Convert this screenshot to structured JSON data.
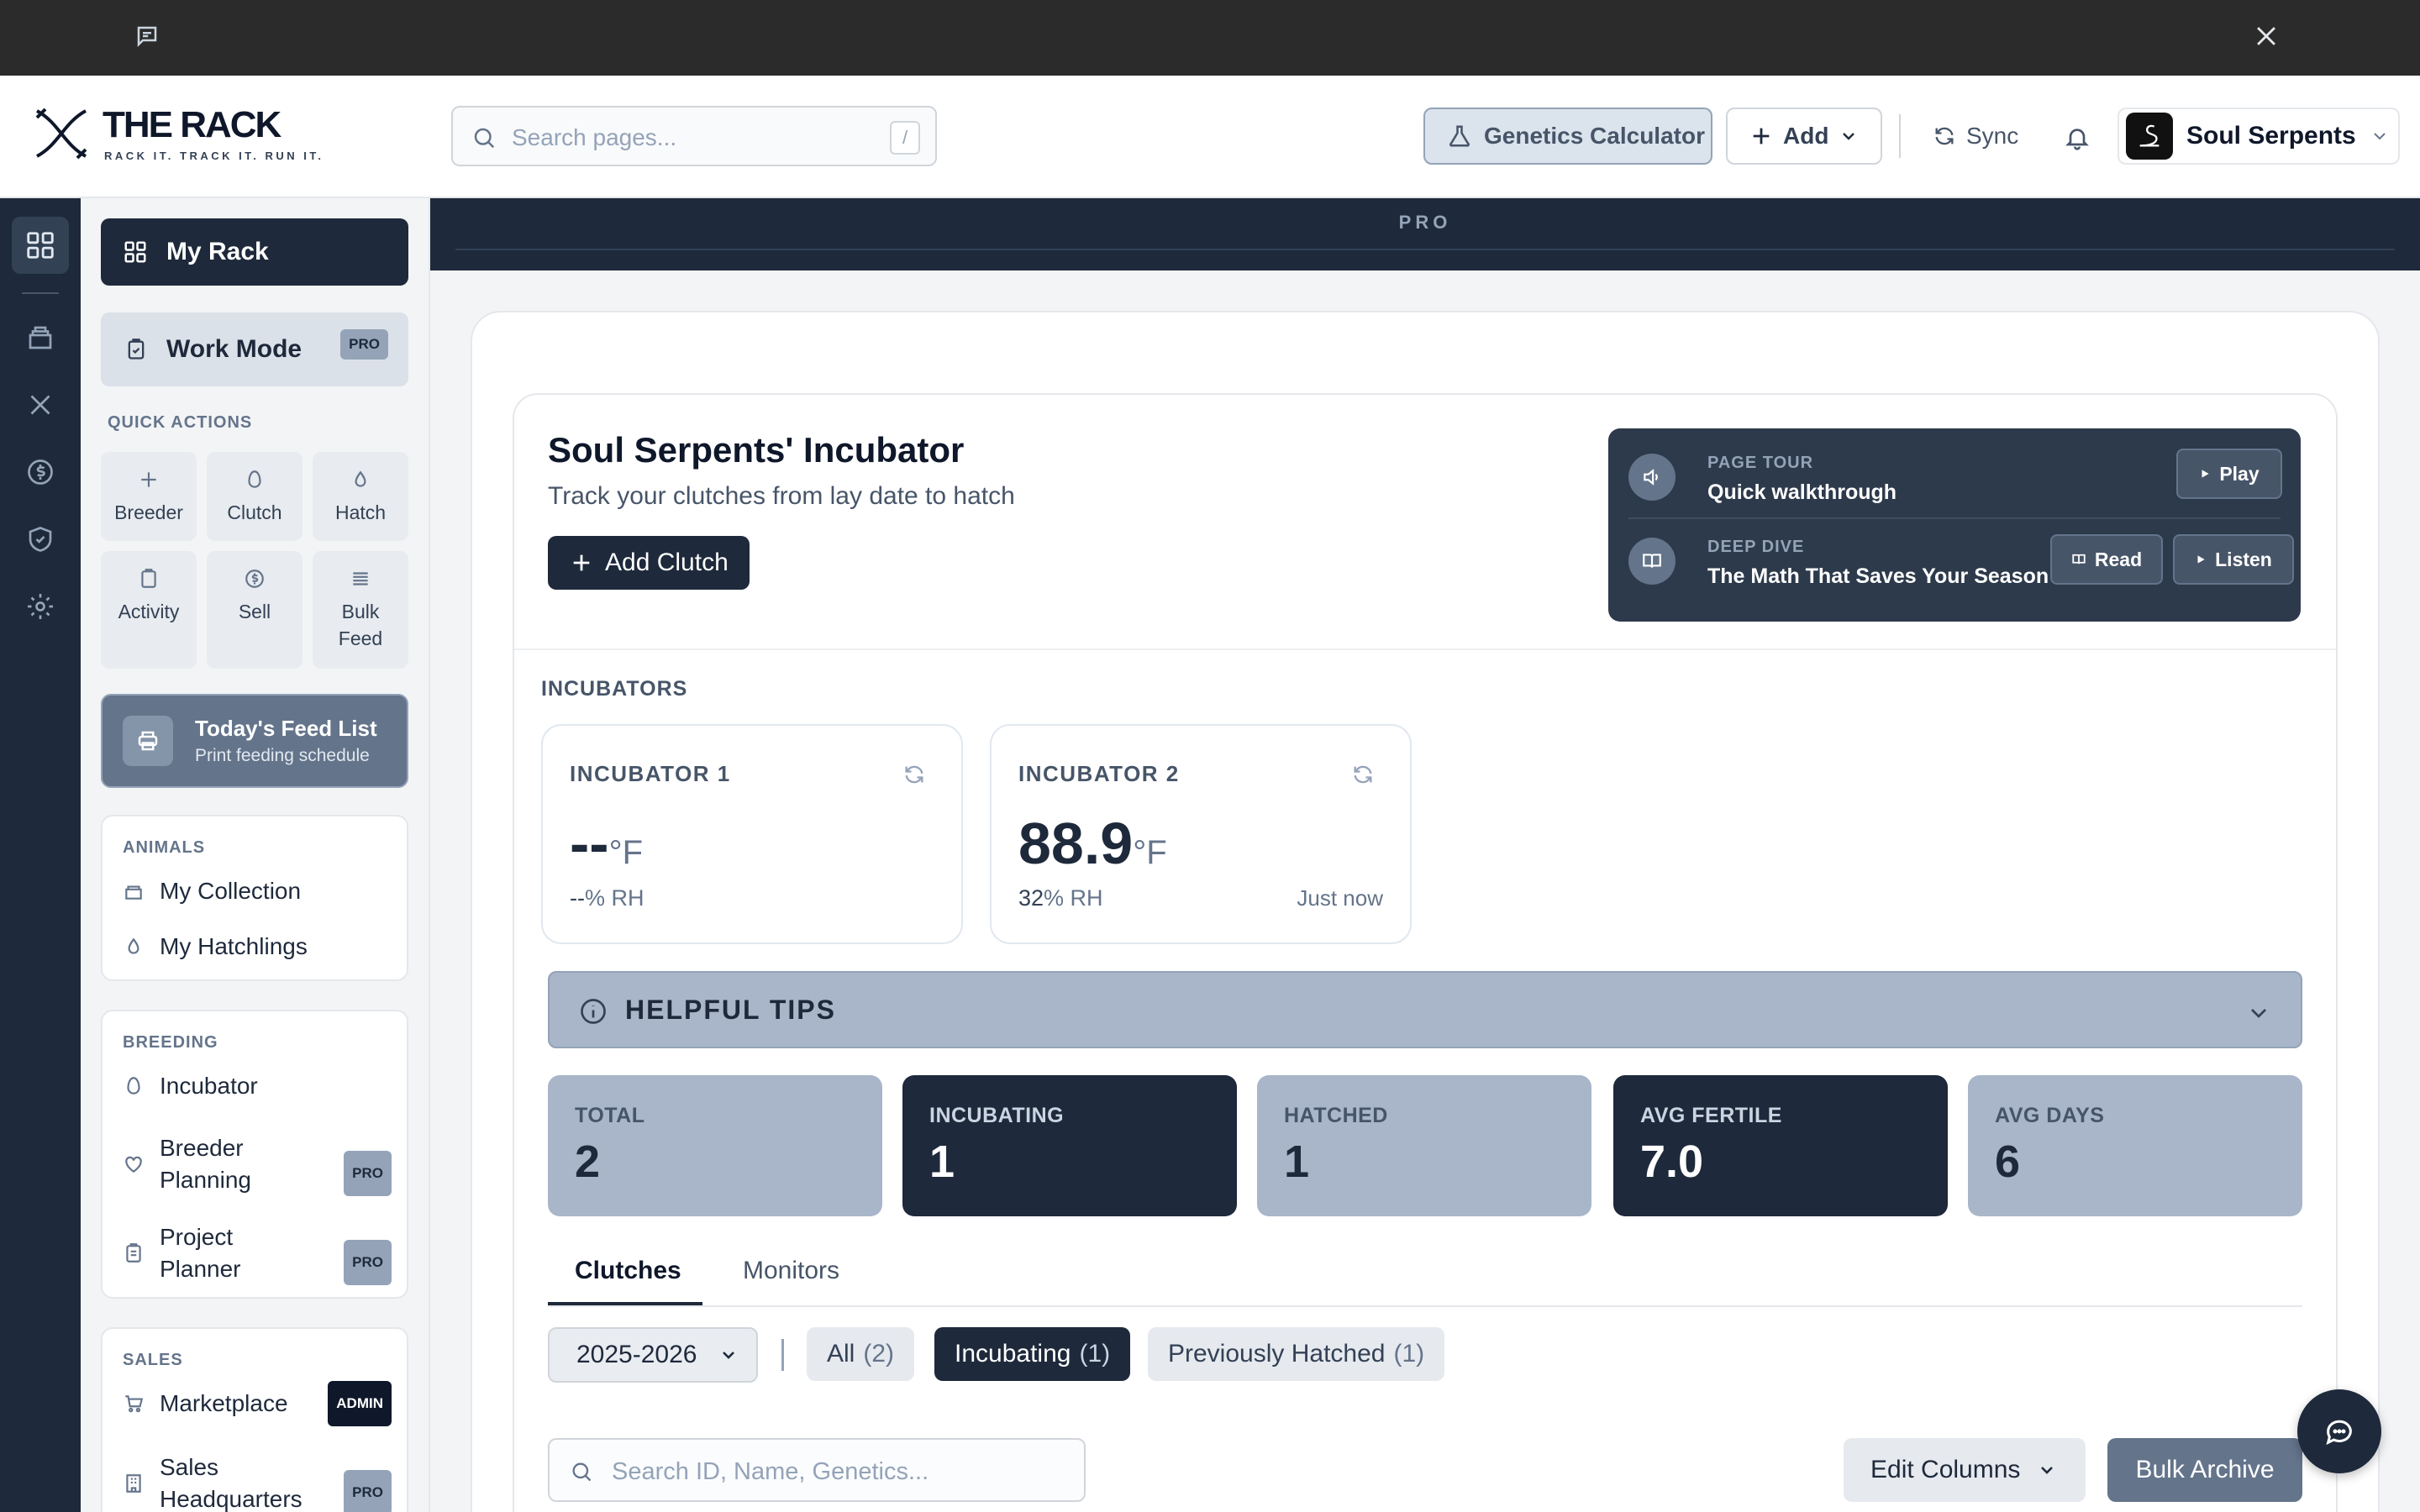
{
  "window": {
    "chat_icon": "message-square-icon",
    "close_icon": "x-icon"
  },
  "brand": {
    "name": "THE RACK",
    "tagline": "RACK IT. TRACK IT. RUN IT."
  },
  "header": {
    "search_placeholder": "Search pages...",
    "search_shortcut": "/",
    "genetics_label": "Genetics Calculator",
    "add_label": "Add",
    "sync_label": "Sync",
    "profile_name": "Soul Serpents"
  },
  "sidebar": {
    "my_rack": "My Rack",
    "work_mode": "Work Mode",
    "work_mode_badge": "PRO",
    "quick_actions_label": "QUICK ACTIONS",
    "quick_actions": [
      {
        "label": "Breeder",
        "icon": "plus-icon"
      },
      {
        "label": "Clutch",
        "icon": "egg-icon"
      },
      {
        "label": "Hatch",
        "icon": "drop-icon"
      },
      {
        "label": "Activity",
        "icon": "clipboard-icon"
      },
      {
        "label": "Sell",
        "icon": "dollar-icon"
      },
      {
        "label": "Bulk Feed",
        "icon": "lines-icon"
      }
    ],
    "feed_list": {
      "title": "Today's Feed List",
      "subtitle": "Print feeding schedule"
    },
    "animals": {
      "label": "ANIMALS",
      "items": [
        "My Collection",
        "My Hatchlings"
      ]
    },
    "breeding": {
      "label": "BREEDING",
      "items": [
        {
          "label": "Incubator",
          "badge": ""
        },
        {
          "label": "Breeder Planning",
          "badge": "PRO"
        },
        {
          "label": "Project Planner",
          "badge": "PRO"
        }
      ]
    },
    "sales": {
      "label": "SALES",
      "items": [
        {
          "label": "Marketplace",
          "badge": "ADMIN"
        },
        {
          "label": "Sales Headquarters",
          "badge": "PRO"
        }
      ]
    }
  },
  "pro_bar": "PRO",
  "incubator_page": {
    "title": "Soul Serpents' Incubator",
    "subtitle": "Track your clutches from lay date to hatch",
    "add_clutch": "Add Clutch",
    "tour": {
      "page_tour_label": "PAGE TOUR",
      "page_tour_title": "Quick walkthrough",
      "play": "Play",
      "deep_dive_label": "DEEP DIVE",
      "deep_dive_title": "The Math That Saves Your Season",
      "read": "Read",
      "listen": "Listen"
    },
    "incubators_label": "INCUBATORS",
    "incubators": [
      {
        "name": "INCUBATOR 1",
        "temp": "--",
        "temp_unit": "°F",
        "rh": "--",
        "rh_unit": "% RH",
        "updated": ""
      },
      {
        "name": "INCUBATOR 2",
        "temp": "88.9",
        "temp_unit": "°F",
        "rh": "32",
        "rh_unit": "% RH",
        "updated": "Just now"
      }
    ],
    "tips_label": "HELPFUL TIPS",
    "stats": [
      {
        "label": "TOTAL",
        "value": "2"
      },
      {
        "label": "INCUBATING",
        "value": "1"
      },
      {
        "label": "HATCHED",
        "value": "1"
      },
      {
        "label": "AVG FERTILE",
        "value": "7.0"
      },
      {
        "label": "AVG DAYS",
        "value": "6"
      }
    ],
    "tabs": [
      "Clutches",
      "Monitors"
    ],
    "season": "2025-2026",
    "filters": [
      {
        "label": "All",
        "count": "(2)"
      },
      {
        "label": "Incubating",
        "count": "(1)"
      },
      {
        "label": "Previously Hatched",
        "count": "(1)"
      }
    ],
    "search_placeholder": "Search ID, Name, Genetics...",
    "edit_columns": "Edit Columns",
    "bulk_archive": "Bulk Archive"
  },
  "colors": {
    "dark": "#1e293b",
    "slate_light": "#a9b6c9",
    "accent_gray": "#64748b"
  }
}
